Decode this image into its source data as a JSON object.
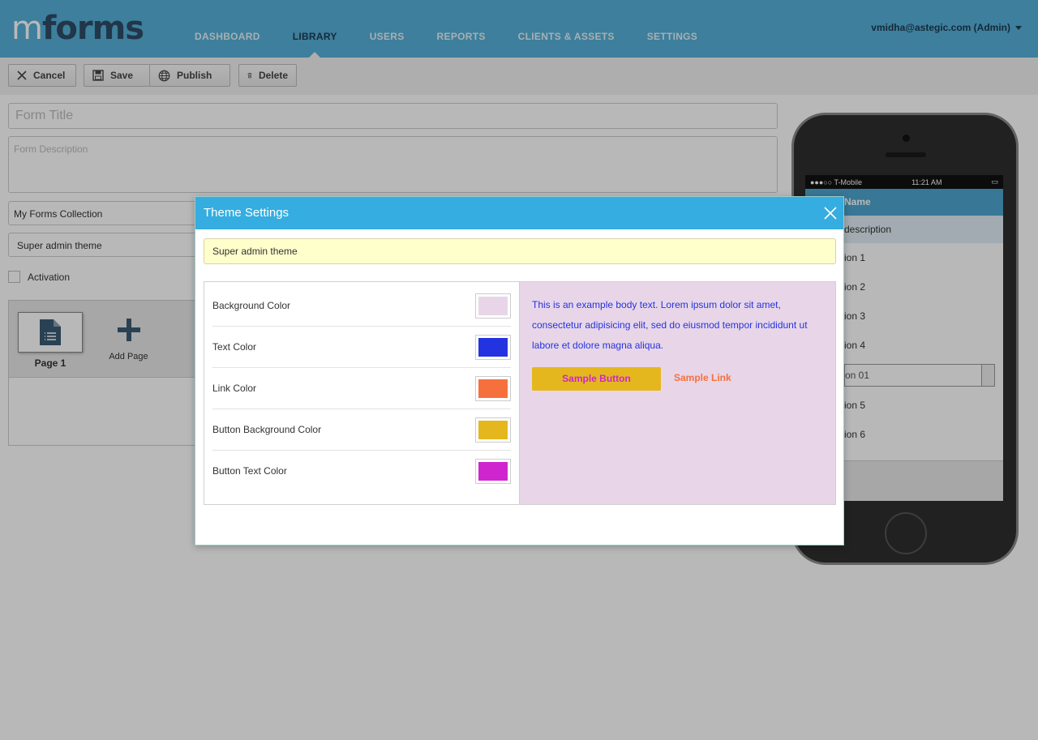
{
  "app": {
    "logo_m": "m",
    "logo_forms": "forms",
    "nav": [
      {
        "label": "DASHBOARD"
      },
      {
        "label": "LIBRARY"
      },
      {
        "label": "USERS"
      },
      {
        "label": "REPORTS"
      },
      {
        "label": "CLIENTS & ASSETS"
      },
      {
        "label": "SETTINGS"
      }
    ],
    "active_nav": "LIBRARY",
    "user": "vmidha@astegic.com (Admin)"
  },
  "toolbar": {
    "cancel_label": "Cancel",
    "save_label": "Save",
    "publish_label": "Publish",
    "delete_label": "Delete"
  },
  "form": {
    "title_placeholder": "Form Title",
    "description_placeholder": "Form Description",
    "collection_value": "My Forms Collection",
    "theme_value": "Super admin theme",
    "activation_label": "Activation",
    "page1_label": "Page 1",
    "add_page_label": "Add Page"
  },
  "phone": {
    "carrier": "●●●○○ T-Mobile",
    "time": "11:21 AM",
    "name_label": "Name",
    "description_label": "description",
    "options": [
      "ion 1",
      "ion 2",
      "ion 3",
      "ion 4"
    ],
    "select_value": "on 01",
    "options_after": [
      "ion 5",
      "ion 6"
    ]
  },
  "modal": {
    "title": "Theme Settings",
    "theme_name": "Super admin theme",
    "color_settings": [
      {
        "label": "Background Color",
        "color": "#e8d6e8"
      },
      {
        "label": "Text Color",
        "color": "#2433e0"
      },
      {
        "label": "Link Color",
        "color": "#f6703d"
      },
      {
        "label": "Button Background Color",
        "color": "#e5b71f"
      },
      {
        "label": "Button Text Color",
        "color": "#cf25cf"
      }
    ],
    "preview_text": "This is an example body text. Lorem ipsum dolor sit amet, consectetur adipisicing elit, sed do eiusmod tempor incididunt ut labore et dolore magna aliqua.",
    "sample_button": "Sample Button",
    "sample_link": "Sample Link"
  },
  "colors": {
    "header": "#55b0d8",
    "modal_header": "#35ade0",
    "preview_bg": "#e8d6e8",
    "preview_text": "#2433e0",
    "link": "#f6703d",
    "button_bg": "#e5b71f",
    "button_text": "#cf25cf"
  }
}
